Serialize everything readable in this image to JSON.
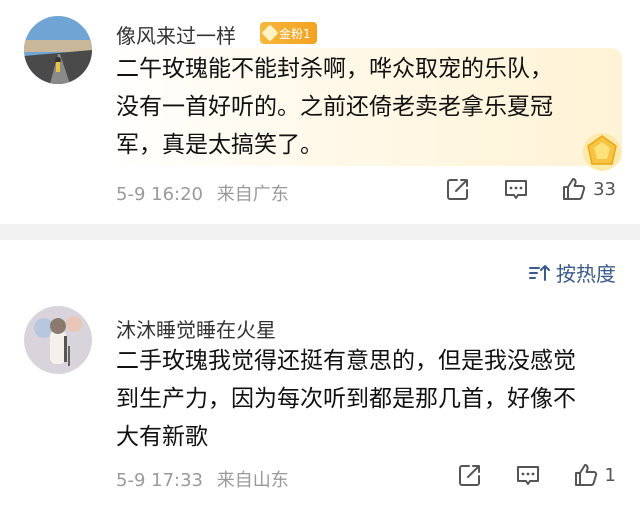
{
  "comments": [
    {
      "username": "像风来过一样",
      "badge_label": "金粉1",
      "text_lines": [
        "二午玫瑰能不能封杀啊，哗众取宠的乐队，",
        "没有一首好听的。之前还倚老卖老拿乐夏冠",
        "军，真是太搞笑了。"
      ],
      "timestamp": "5-9 16:20",
      "location": "来自广东",
      "like_count": "33"
    },
    {
      "username": "沐沐睡觉睡在火星",
      "text_lines": [
        "二手玫瑰我觉得还挺有意思的，但是我没感觉",
        "到生产力，因为每次听到都是那几首，好像不",
        "大有新歌"
      ],
      "timestamp": "5-9 17:33",
      "location": "来自山东",
      "like_count": "1"
    }
  ],
  "sort": {
    "label": "按热度"
  },
  "colors": {
    "accent": "#3b5a8a",
    "meta": "#9a9a9a",
    "badge": "#f3a21f"
  }
}
